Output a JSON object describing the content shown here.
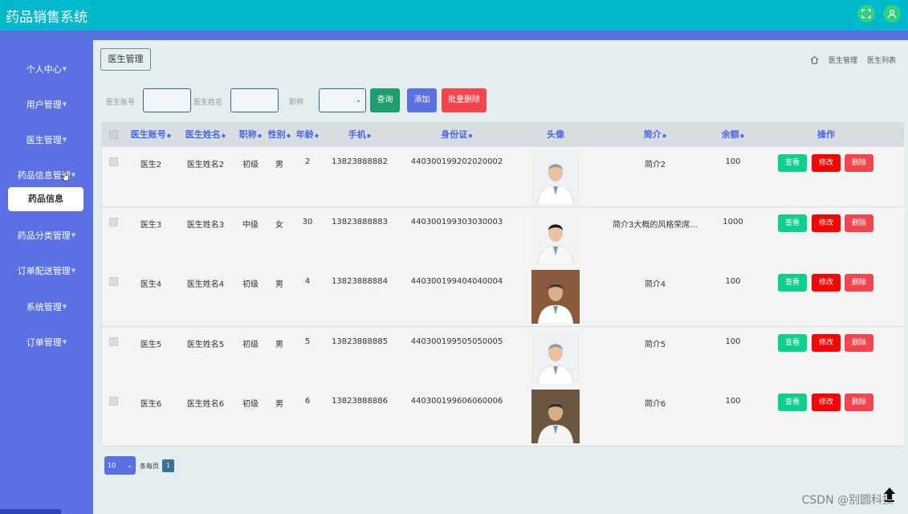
{
  "app": {
    "title": "药品销售系统",
    "colors": {
      "header": "#00b8cc",
      "sidebar": "#5a70e3",
      "view": "#0fcf8d",
      "edit": "#ff0000",
      "delete": "#f2454e",
      "search": "#1e9d6e",
      "add": "#5a70e3",
      "batch_delete": "#f2454e"
    }
  },
  "header": {
    "fullscreen_icon": "fullscreen-icon",
    "user_icon": "user-icon"
  },
  "sidebar": {
    "items": [
      {
        "label": "个人中心"
      },
      {
        "label": "用户管理"
      },
      {
        "label": "医生管理"
      },
      {
        "label": "药品信息管理"
      },
      {
        "label": "药品分类管理"
      },
      {
        "label": "订单配送管理"
      },
      {
        "label": "系统管理"
      },
      {
        "label": "订单管理"
      }
    ],
    "active_sub": "药品信息"
  },
  "page": {
    "tab": "医生管理",
    "breadcrumb": [
      "医生管理",
      "医生列表"
    ]
  },
  "search": {
    "account_label": "医生账号",
    "name_label": "医生姓名",
    "title_label": "职称",
    "query_btn": "查询",
    "add_btn": "添加",
    "batch_delete_btn": "批量删除"
  },
  "table": {
    "headers": {
      "account": "医生账号",
      "name": "医生姓名",
      "title": "职称",
      "gender": "性别",
      "age": "年龄",
      "phone": "手机",
      "id_card": "身份证",
      "avatar": "头像",
      "intro": "简介",
      "balance": "余额",
      "actions": "操作"
    },
    "rows": [
      {
        "account": "医生2",
        "name": "医生姓名2",
        "title": "初级",
        "gender": "男",
        "age": "2",
        "phone": "13823888882",
        "id_card": "440300199202020002",
        "intro": "简介2",
        "balance": "100"
      },
      {
        "account": "医生3",
        "name": "医生姓名3",
        "title": "中级",
        "gender": "女",
        "age": "30",
        "phone": "13823888883",
        "id_card": "440300199303030003",
        "intro": "简介3大概的风格荣席...",
        "balance": "1000"
      },
      {
        "account": "医生4",
        "name": "医生姓名4",
        "title": "初级",
        "gender": "男",
        "age": "4",
        "phone": "13823888884",
        "id_card": "440300199404040004",
        "intro": "简介4",
        "balance": "100"
      },
      {
        "account": "医生5",
        "name": "医生姓名5",
        "title": "初级",
        "gender": "男",
        "age": "5",
        "phone": "13823888885",
        "id_card": "440300199505050005",
        "intro": "简介5",
        "balance": "100"
      },
      {
        "account": "医生6",
        "name": "医生姓名6",
        "title": "初级",
        "gender": "男",
        "age": "6",
        "phone": "13823888886",
        "id_card": "440300199606060006",
        "intro": "简介6",
        "balance": "100"
      }
    ],
    "actions": {
      "view": "查看",
      "edit": "修改",
      "delete": "删除"
    }
  },
  "pagination": {
    "page_size": "10",
    "per_page_label": "条每页",
    "current_page": "1"
  },
  "watermark": "CSDN @别圆科技"
}
